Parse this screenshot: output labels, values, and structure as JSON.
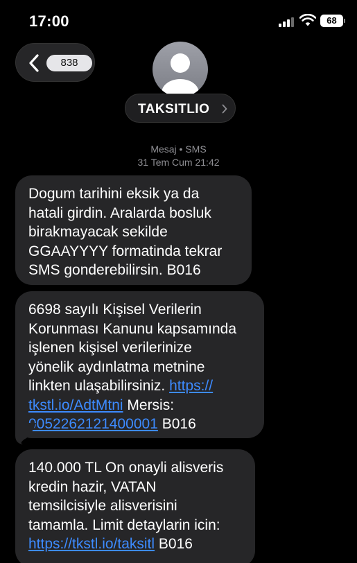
{
  "status_bar": {
    "time": "17:00",
    "battery_level": "68",
    "icons": [
      "cellular-signal-icon",
      "wifi-icon",
      "battery-icon"
    ]
  },
  "header": {
    "back_icon": "chevron-left-icon",
    "unread_count": "838",
    "avatar_icon": "person-silhouette-icon",
    "contact_name": "TAKSITLIO",
    "contact_chevron": "chevron-right-icon"
  },
  "thread": {
    "service": "Mesaj • SMS",
    "timestamp": "31 Tem Cum 21:42"
  },
  "messages": [
    {
      "lines": [
        "Dogum tarihini eksik ya da",
        "hatali girdin. Aralarda bosluk",
        "birakmayacak sekilde",
        "GGAAYYYY formatinda tekrar",
        "SMS gonderebilirsin. B016"
      ]
    },
    {
      "line1": "6698 sayılı Kişisel Verilerin",
      "line2": "Korunması Kanunu kapsamında",
      "line3": "işlenen kişisel verilerinize",
      "line4": "yönelik aydınlatma metnine",
      "line5_text": "linkten ulaşabilirsiniz.",
      "link_part1": "https://",
      "link_part2": "tkstl.io/AdtMtni",
      "mersis_label": "Mersis:",
      "mersis_number": "0052262121400001",
      "code": "B016"
    },
    {
      "line1": "140.000 TL On onayli alisveris",
      "line2": "kredin hazir, VATAN",
      "line3": "temsilcisiyle alisverisini",
      "line4": "tamamla. Limit detaylarin icin:",
      "link": "https://tkstl.io/taksitl",
      "code": "B016"
    }
  ],
  "colors": {
    "background": "#000000",
    "bubble": "#262628",
    "link": "#3d8bff",
    "meta_text": "#8e8e93"
  }
}
